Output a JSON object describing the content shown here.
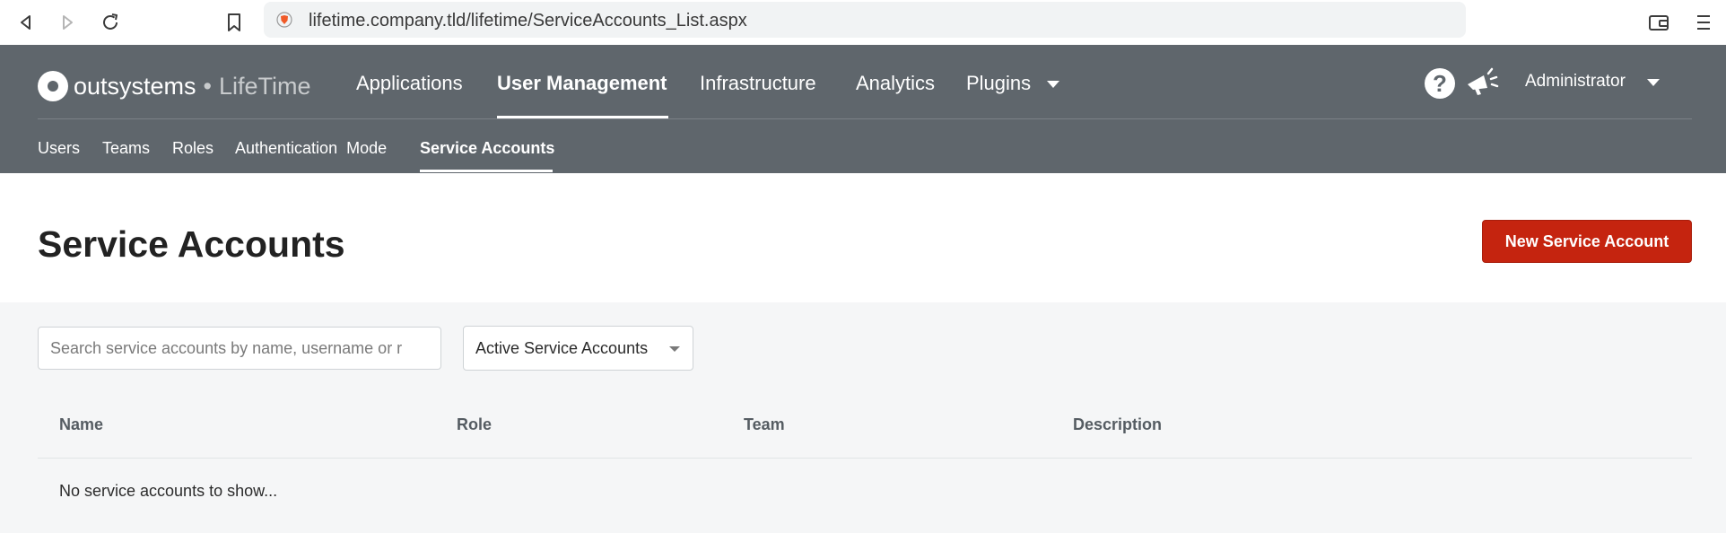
{
  "browser": {
    "url": "lifetime.company.tld/lifetime/ServiceAccounts_List.aspx"
  },
  "logo": {
    "brand": "outsystems",
    "separator": "•",
    "product": "LifeTime"
  },
  "main_nav": {
    "items": [
      {
        "label": "Applications"
      },
      {
        "label": "User Management",
        "active": true
      },
      {
        "label": "Infrastructure"
      },
      {
        "label": "Analytics"
      },
      {
        "label": "Plugins"
      }
    ]
  },
  "header_right": {
    "help_glyph": "?",
    "user": "Administrator"
  },
  "sub_nav": {
    "items": [
      {
        "label": "Users"
      },
      {
        "label": "Teams"
      },
      {
        "label": "Roles"
      },
      {
        "label": "Authentication  Mode"
      },
      {
        "label": "Service Accounts",
        "active": true
      }
    ]
  },
  "page": {
    "title": "Service Accounts",
    "new_button": "New Service Account"
  },
  "filters": {
    "search_placeholder": "Search service accounts by name, username or r",
    "status_value": "Active Service Accounts"
  },
  "table": {
    "columns": [
      "Name",
      "Role",
      "Team",
      "Description"
    ],
    "empty_message": "No service accounts to show..."
  },
  "colors": {
    "header_bg": "#5f666c",
    "primary_button": "#c5240f",
    "page_bg": "#f5f6f7"
  }
}
